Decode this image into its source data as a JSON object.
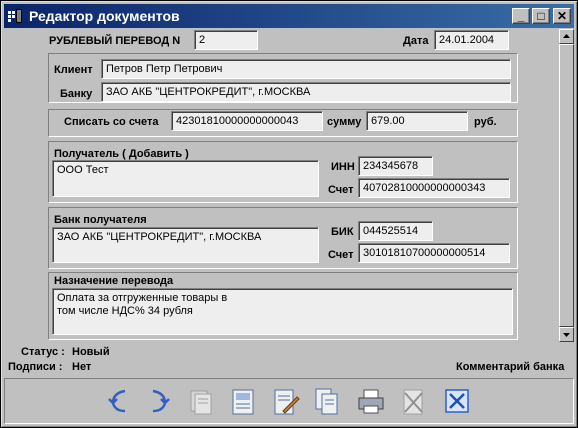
{
  "window": {
    "title": "Редактор документов"
  },
  "titlebar_buttons": {
    "minimize": "_",
    "maximize": "□",
    "close": "✕"
  },
  "header": {
    "doc_label": "РУБЛЕВЫЙ ПЕРЕВОД N",
    "doc_number": "2",
    "date_label": "Дата",
    "date_value": "24.01.2004"
  },
  "client": {
    "client_label": "Клиент",
    "client_value": "Петров Петр Петрович",
    "bank_label": "Банку",
    "bank_value": "ЗАО АКБ \"ЦЕНТРОКРЕДИТ\", г.МОСКВА"
  },
  "debit": {
    "label": "Списать со счета",
    "account": "42301810000000000043",
    "sum_label": "сумму",
    "sum_value": "679.00",
    "currency": "руб."
  },
  "recipient": {
    "title": "Получатель ( Добавить )",
    "name": "ООО Тест",
    "inn_label": "ИНН",
    "inn_value": "234345678",
    "account_label": "Счет",
    "account_value": "40702810000000000343"
  },
  "recipient_bank": {
    "title": "Банк получателя",
    "name": "ЗАО АКБ \"ЦЕНТРОКРЕДИТ\", г.МОСКВА",
    "bik_label": "БИК",
    "bik_value": "044525514",
    "account_label": "Счет",
    "account_value": "30101810700000000514"
  },
  "purpose": {
    "title": "Назначение перевода",
    "line1": "Оплата за отгруженные товары в",
    "line2": "том числе НДС% 34 рубля"
  },
  "status": {
    "status_label": "Статус :",
    "status_value": "Новый",
    "sign_label": "Подписи :",
    "sign_value": "Нет",
    "bank_comment": "Комментарий банка"
  },
  "toolbar": {
    "icons": [
      "undo-icon",
      "redo-icon",
      "copy-disabled-icon",
      "doc-icon",
      "edit-doc-icon",
      "duplicate-icon",
      "print-icon",
      "delete-disabled-icon",
      "close-doc-icon"
    ]
  }
}
